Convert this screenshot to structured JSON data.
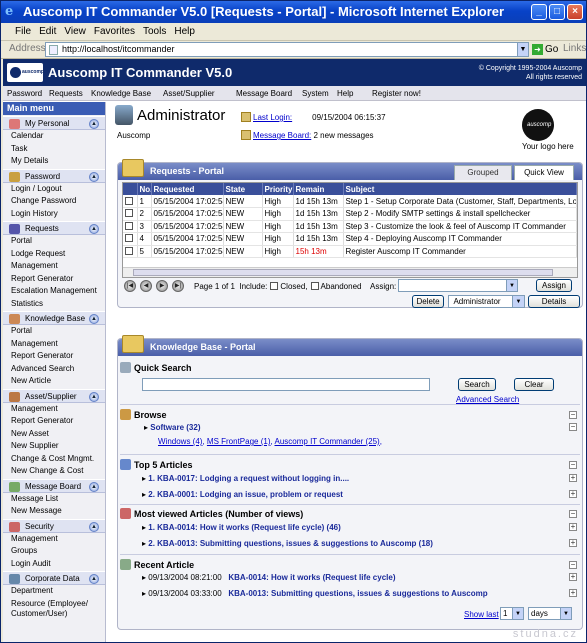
{
  "window": {
    "title": "Auscomp IT Commander V5.0 [Requests - Portal] - Microsoft Internet Explorer"
  },
  "browser_menu": [
    "File",
    "Edit",
    "View",
    "Favorites",
    "Tools",
    "Help"
  ],
  "address": {
    "label": "Address",
    "url": "http://localhost/itcommander",
    "go": "Go",
    "links": "Links"
  },
  "banner": {
    "app": "Auscomp IT Commander V5.0",
    "copyright": "© Copyright 1995-2004 Auscomp\nAll rights reserved"
  },
  "topnav": [
    "Password",
    "Requests",
    "Knowledge Base",
    "Asset/Supplier",
    "Message Board",
    "System",
    "Help",
    "Register now!"
  ],
  "sidebar": {
    "title": "Main menu",
    "groups": [
      {
        "label": "My Personal",
        "items": [
          "Calendar",
          "Task",
          "My Details"
        ]
      },
      {
        "label": "Password",
        "items": [
          "Login / Logout",
          "Change Password",
          "Login History"
        ]
      },
      {
        "label": "Requests",
        "items": [
          "Portal",
          "Lodge Request",
          "Management",
          "Report Generator",
          "Escalation Management",
          "Statistics"
        ]
      },
      {
        "label": "Knowledge Base",
        "items": [
          "Portal",
          "Management",
          "Report Generator",
          "Advanced Search",
          "New Article"
        ]
      },
      {
        "label": "Asset/Supplier",
        "items": [
          "Management",
          "Report Generator",
          "New Asset",
          "New Supplier",
          "Change & Cost Mngmt.",
          "New Change & Cost"
        ]
      },
      {
        "label": "Message Board",
        "items": [
          "Message List",
          "New Message"
        ]
      },
      {
        "label": "Security",
        "items": [
          "Management",
          "Groups",
          "Login Audit"
        ]
      },
      {
        "label": "Corporate Data",
        "items": [
          "Department",
          "Resource (Employee/ Customer/User)"
        ]
      }
    ]
  },
  "user": {
    "name": "Administrator",
    "org": "Auscomp",
    "last_login_label": "Last Login:",
    "last_login": "09/15/2004 06:15:37",
    "message_board_label": "Message Board:",
    "message_board_text": "2 new messages",
    "your_logo": "Your logo here",
    "logo_text": "auscomp"
  },
  "requests": {
    "title": "Requests - Portal",
    "tabs": [
      "Grouped",
      "Quick View"
    ],
    "columns": [
      "No.",
      "Requested",
      "State",
      "Priority",
      "Remain",
      "Subject"
    ],
    "rows": [
      {
        "no": "1",
        "requested": "05/15/2004 17:02:54",
        "state": "NEW",
        "priority": "High",
        "remain": "1d 15h 13m",
        "subject": "Step 1 - Setup Corporate Data (Customer, Staff, Departments, Location"
      },
      {
        "no": "2",
        "requested": "05/15/2004 17:02:54",
        "state": "NEW",
        "priority": "High",
        "remain": "1d 15h 13m",
        "subject": "Step 2 - Modify SMTP settings & install spellchecker"
      },
      {
        "no": "3",
        "requested": "05/15/2004 17:02:54",
        "state": "NEW",
        "priority": "High",
        "remain": "1d 15h 13m",
        "subject": "Step 3 - Customize the look & feel of Auscomp IT Commander"
      },
      {
        "no": "4",
        "requested": "05/15/2004 17:02:54",
        "state": "NEW",
        "priority": "High",
        "remain": "1d 15h 13m",
        "subject": "Step 4 - Deploying Auscomp IT Commander"
      },
      {
        "no": "5",
        "requested": "05/15/2004 17:02:54",
        "state": "NEW",
        "priority": "High",
        "remain": "15h 13m",
        "subject": "Register Auscomp IT Commander"
      }
    ],
    "page_text": "Page 1 of 1",
    "include_label": "Include:",
    "closed_label": "Closed,",
    "abandoned_label": "Abandoned",
    "assign_label": "Assign:",
    "assign_button": "Assign",
    "delete_button": "Delete",
    "admin_select": "Administrator",
    "details_button": "Details"
  },
  "kb": {
    "title": "Knowledge Base - Portal",
    "quick_search": "Quick Search",
    "search_button": "Search",
    "clear_button": "Clear",
    "advanced_search": "Advanced Search",
    "browse": "Browse",
    "software": "Software (32)",
    "software_links": [
      "Windows (4)",
      "MS FrontPage (1)",
      "Auscomp IT Commander (25)"
    ],
    "top5": "Top 5 Articles",
    "top5_items": [
      "1. KBA-0017: Lodging a request without logging in....",
      "2. KBA-0001: Lodging an issue, problem or request"
    ],
    "most_viewed": "Most viewed Articles (Number of views)",
    "most_viewed_items": [
      "1. KBA-0014: How it works (Request life cycle)  (46)",
      "2. KBA-0013: Submitting questions, issues & suggestions to Auscomp (18)"
    ],
    "recent": "Recent Article",
    "recent_items": [
      {
        "date": "09/13/2004 08:21:00",
        "title": "KBA-0014: How it works (Request life cycle)"
      },
      {
        "date": "09/13/2004 03:33:00",
        "title": "KBA-0013: Submitting questions, issues & suggestions to Auscomp"
      }
    ],
    "show_last": "Show last",
    "show_last_value": "1",
    "unit": "days"
  },
  "watermark": "studna.cz"
}
